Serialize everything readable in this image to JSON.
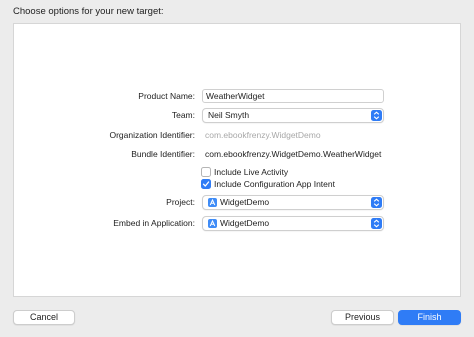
{
  "sheet": {
    "title": "Choose options for your new target:"
  },
  "form": {
    "product_name": {
      "label": "Product Name:",
      "value": "WeatherWidget"
    },
    "team": {
      "label": "Team:",
      "value": "Neil Smyth"
    },
    "organization_identifier": {
      "label": "Organization Identifier:",
      "placeholder": "com.ebookfrenzy.WidgetDemo"
    },
    "bundle_identifier": {
      "label": "Bundle Identifier:",
      "value": "com.ebookfrenzy.WidgetDemo.WeatherWidget"
    },
    "include_live_activity": {
      "label": "Include Live Activity",
      "checked": false
    },
    "include_configuration_intent": {
      "label": "Include Configuration App Intent",
      "checked": true
    },
    "project": {
      "label": "Project:",
      "value": "WidgetDemo",
      "icon": "xcode-project-icon"
    },
    "embed_in_application": {
      "label": "Embed in Application:",
      "value": "WidgetDemo",
      "icon": "app-icon"
    }
  },
  "buttons": {
    "cancel": "Cancel",
    "previous": "Previous",
    "finish": "Finish"
  },
  "colors": {
    "accent": "#2f7cf6",
    "window_bg": "#ececec",
    "panel_bg": "#ffffff",
    "placeholder": "#a8a8a8"
  }
}
